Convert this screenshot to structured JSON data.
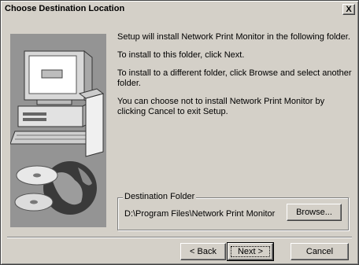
{
  "window": {
    "title": "Choose Destination Location",
    "close_glyph": "X"
  },
  "body": {
    "paragraphs": [
      "Setup will install Network Print Monitor in the following folder.",
      "To install to this folder, click Next.",
      "To install to a different folder, click Browse and select another folder.",
      "You can choose not to install Network Print Monitor by clicking Cancel to exit Setup."
    ]
  },
  "destination": {
    "legend": "Destination Folder",
    "path": "D:\\Program Files\\Network Print Monitor",
    "browse_label": "Browse..."
  },
  "buttons": {
    "back": "< Back",
    "next": "Next >",
    "cancel": "Cancel"
  },
  "icons": {
    "setup_art": "computer-with-discs-and-globe-illustration",
    "close": "close-icon"
  }
}
